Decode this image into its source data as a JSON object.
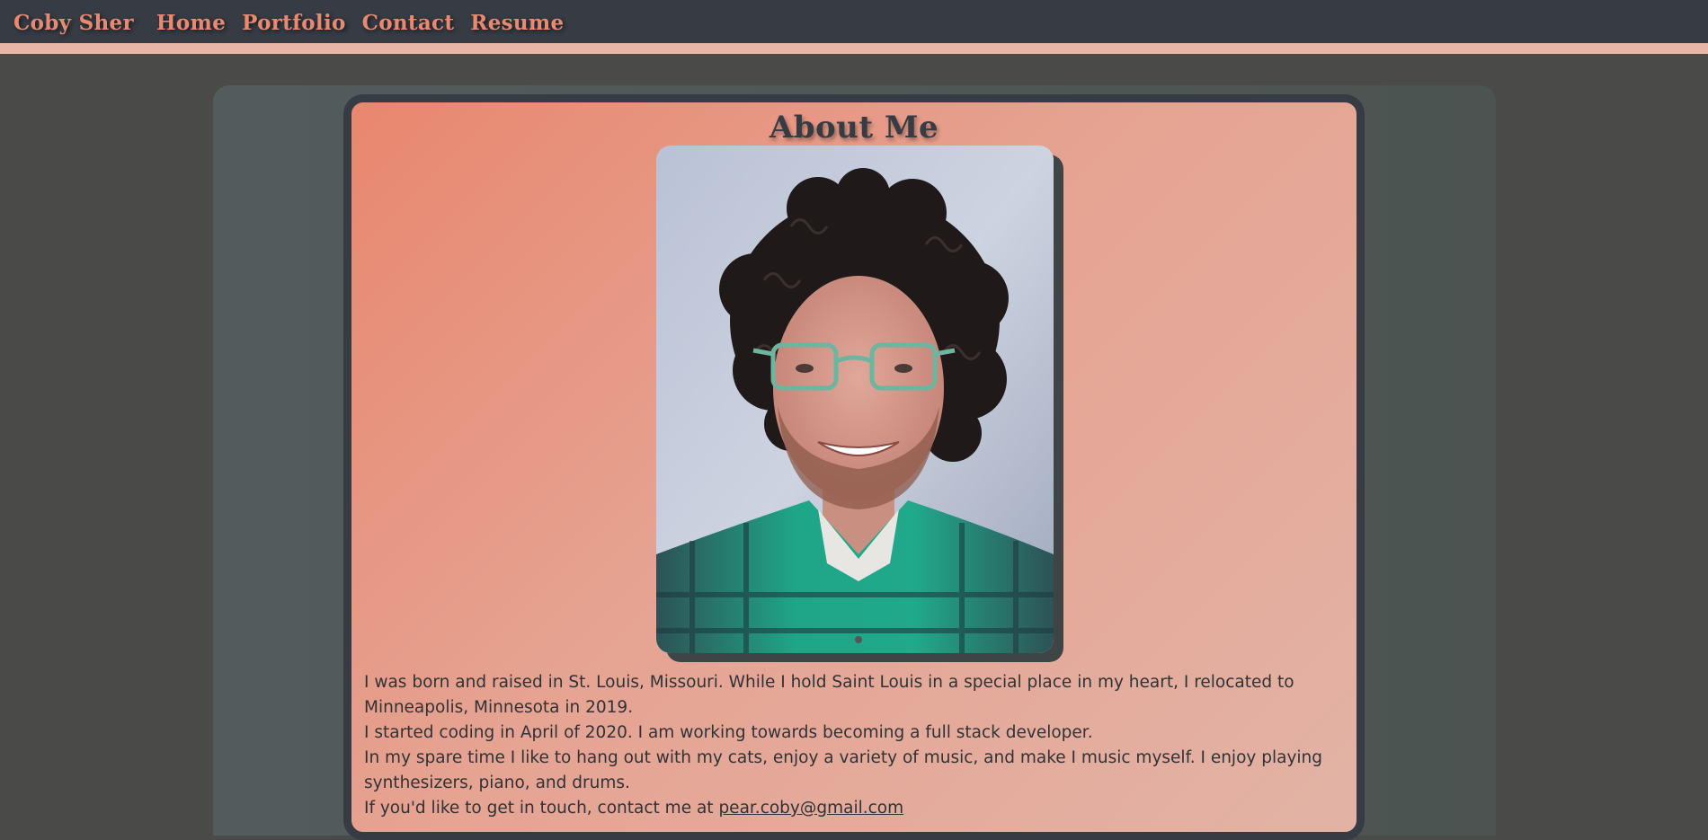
{
  "nav": {
    "brand": "Coby Sher",
    "links": [
      "Home",
      "Portfolio",
      "Contact",
      "Resume"
    ]
  },
  "about": {
    "title": "About Me",
    "paragraphs": [
      "I was born and raised in St. Louis, Missouri. While I hold Saint Louis in a special place in my heart, I relocated to Minneapolis, Minnesota in 2019.",
      "I started coding in April of 2020. I am working towards becoming a full stack developer.",
      "In my spare time I like to hang out with my cats, enjoy a variety of music, and make I music myself. I enjoy playing synthesizers, piano, and drums."
    ],
    "contact_prefix": "If you'd like to get in touch, contact me at ",
    "contact_email": "pear.coby@gmail.com"
  },
  "colors": {
    "nav_bg": "#363b44",
    "accent": "#e88a72",
    "nav_underline": "#e8b6a6",
    "page_bg": "#4a4b48",
    "text_dark": "#363b44"
  }
}
